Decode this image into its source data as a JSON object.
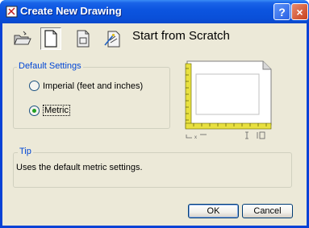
{
  "window": {
    "title": "Create New Drawing",
    "help_label": "?",
    "close_label": "×"
  },
  "toolbar": {
    "icons": [
      "open-drawing-icon",
      "start-from-scratch-icon",
      "use-template-icon",
      "use-wizard-icon"
    ],
    "selected": "start-from-scratch-icon"
  },
  "heading": "Start from Scratch",
  "default_settings": {
    "label": "Default Settings",
    "options": [
      {
        "label": "Imperial (feet and inches)",
        "checked": false
      },
      {
        "label": "Metric",
        "checked": true
      }
    ]
  },
  "tip": {
    "label": "Tip",
    "text": "Uses the default metric settings."
  },
  "buttons": {
    "ok": "OK",
    "cancel": "Cancel"
  },
  "colors": {
    "title_bar": "#0a4fd8",
    "dialog_face": "#ece9d8",
    "group_label": "#0046d5",
    "ruler": "#e8e040",
    "radio_dot": "#21a121"
  }
}
